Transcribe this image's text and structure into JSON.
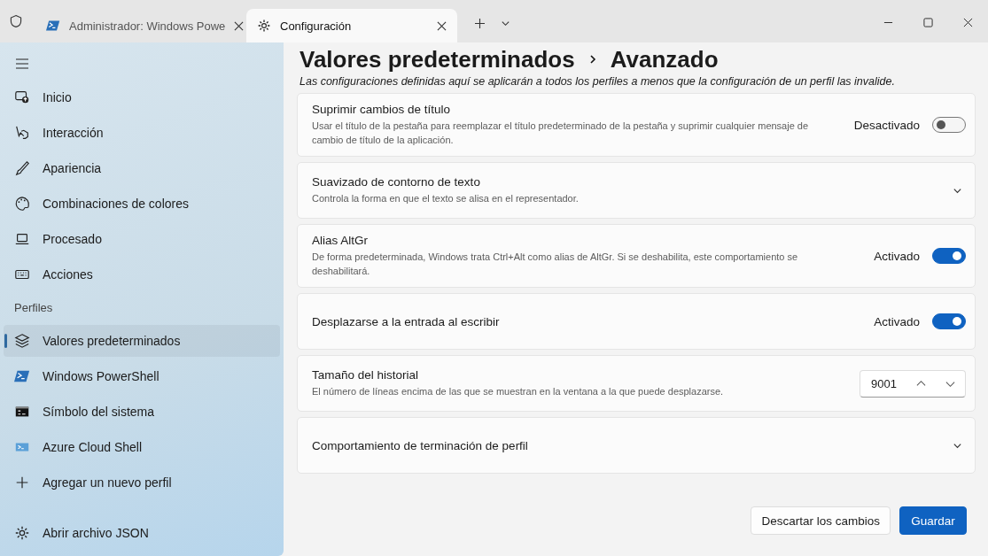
{
  "tabs": [
    {
      "title": "Administrador: Windows Powe",
      "selected": false
    },
    {
      "title": "Configuración",
      "selected": true
    }
  ],
  "sidebar": {
    "items": [
      {
        "label": "Inicio",
        "selected": false
      },
      {
        "label": "Interacción",
        "selected": false
      },
      {
        "label": "Apariencia",
        "selected": false
      },
      {
        "label": "Combinaciones de colores",
        "selected": false
      },
      {
        "label": "Procesado",
        "selected": false
      },
      {
        "label": "Acciones",
        "selected": false
      }
    ],
    "section_label": "Perfiles",
    "profiles": [
      {
        "label": "Valores predeterminados",
        "selected": true
      },
      {
        "label": "Windows PowerShell",
        "selected": false
      },
      {
        "label": "Símbolo del sistema",
        "selected": false
      },
      {
        "label": "Azure Cloud Shell",
        "selected": false
      }
    ],
    "add_profile": "Agregar un nuevo perfil",
    "open_json": "Abrir archivo JSON"
  },
  "breadcrumb": [
    "Valores predeterminados",
    "Avanzado"
  ],
  "description": "Las configuraciones definidas aquí se aplicarán a todos los perfiles a menos que la configuración de un perfil las invalide.",
  "settings": [
    {
      "kind": "toggle",
      "title": "Suprimir cambios de título",
      "description": "Usar el título de la pestaña para reemplazar el título predeterminado de la pestaña y suprimir cualquier mensaje de cambio de título de la aplicación.",
      "state_label": "Desactivado",
      "on": false
    },
    {
      "kind": "expander",
      "title": "Suavizado de contorno de texto",
      "description": "Controla la forma en que el texto se alisa en el representador."
    },
    {
      "kind": "toggle",
      "title": "Alias AltGr",
      "description": "De forma predeterminada, Windows trata Ctrl+Alt como alias de AltGr. Si se deshabilita, este comportamiento se deshabilitará.",
      "state_label": "Activado",
      "on": true
    },
    {
      "kind": "toggle",
      "title": "Desplazarse a la entrada al escribir",
      "state_label": "Activado",
      "on": true
    },
    {
      "kind": "number",
      "title": "Tamaño del historial",
      "description": "El número de líneas encima de las que se muestran en la ventana a la que puede desplazarse.",
      "value": "9001"
    },
    {
      "kind": "expander",
      "title": "Comportamiento de terminación de perfil"
    }
  ],
  "buttons": {
    "discard": "Descartar los cambios",
    "save": "Guardar"
  }
}
